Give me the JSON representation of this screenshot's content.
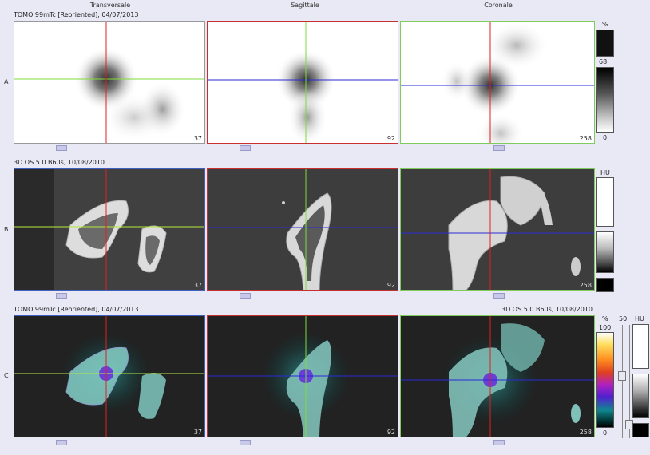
{
  "columns": [
    "Transversale",
    "Sagittale",
    "Coronale"
  ],
  "rows": [
    "A",
    "B",
    "C"
  ],
  "studies": {
    "tomo": "TOMO 99mTc [Reoriented], 04/07/2013",
    "ct": "3D  OS  5.0  B60s, 10/08/2010"
  },
  "slices": [
    "37",
    "92",
    "258"
  ],
  "colorbars": {
    "a_percent_label": "%",
    "a_max": "68",
    "a_min": "0",
    "b_unit": "HU",
    "c_percent_label": "%",
    "c_max": "100",
    "c_min": "0",
    "c_blend": "50",
    "c_unit": "HU"
  },
  "crosshair_colors": {
    "red": "#e02020",
    "green": "#7fdc3c",
    "blue": "#2a2ad8",
    "lime": "#b4e840"
  }
}
